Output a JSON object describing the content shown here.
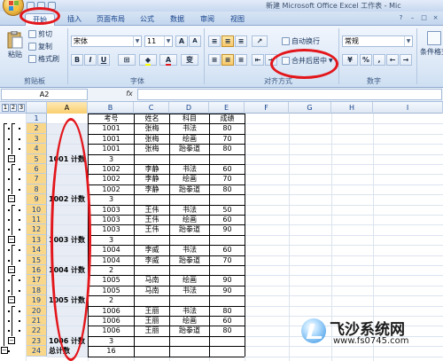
{
  "window": {
    "title": "新建 Microsoft Office Excel 工作表 - Mic"
  },
  "tabs": [
    {
      "label": "开始",
      "active": true
    },
    {
      "label": "插入"
    },
    {
      "label": "页面布局"
    },
    {
      "label": "公式"
    },
    {
      "label": "数据"
    },
    {
      "label": "审阅"
    },
    {
      "label": "视图"
    }
  ],
  "ribbon": {
    "clipboard": {
      "paste": "粘贴",
      "cut": "剪切",
      "copy": "复制",
      "format_painter": "格式刷",
      "label": "剪贴板"
    },
    "font": {
      "name": "宋体",
      "size": "11",
      "grow": "A",
      "shrink": "A",
      "bold": "B",
      "italic": "I",
      "underline": "U",
      "color_letter": "A",
      "phonetic": "变",
      "label": "字体"
    },
    "alignment": {
      "wrap": "自动换行",
      "merge": "合并后居中",
      "label": "对齐方式"
    },
    "number": {
      "format": "常规",
      "percent": "%",
      "comma": ",",
      "label": "数字"
    },
    "styles": {
      "conditional": "条件格式"
    }
  },
  "formula_bar": {
    "name_box": "A2",
    "fx": "fx",
    "value": ""
  },
  "outline_levels": [
    "1",
    "2",
    "3"
  ],
  "columns": [
    "A",
    "B",
    "C",
    "D",
    "E",
    "F",
    "G",
    "H",
    "I"
  ],
  "rows": [
    {
      "n": "1",
      "a": "",
      "b": "考号",
      "c": "姓名",
      "d": "科目",
      "e": "成绩"
    },
    {
      "n": "2",
      "a": "",
      "b": "1001",
      "c": "张梅",
      "d": "书法",
      "e": "80"
    },
    {
      "n": "3",
      "a": "",
      "b": "1001",
      "c": "张梅",
      "d": "绘画",
      "e": "70"
    },
    {
      "n": "4",
      "a": "",
      "b": "1001",
      "c": "张梅",
      "d": "跆拳道",
      "e": "80"
    },
    {
      "n": "5",
      "a": "1001 计数",
      "b": "3",
      "c": "",
      "d": "",
      "e": ""
    },
    {
      "n": "6",
      "a": "",
      "b": "1002",
      "c": "李静",
      "d": "书法",
      "e": "60"
    },
    {
      "n": "7",
      "a": "",
      "b": "1002",
      "c": "李静",
      "d": "绘画",
      "e": "70"
    },
    {
      "n": "8",
      "a": "",
      "b": "1002",
      "c": "李静",
      "d": "跆拳道",
      "e": "80"
    },
    {
      "n": "9",
      "a": "1002 计数",
      "b": "3",
      "c": "",
      "d": "",
      "e": ""
    },
    {
      "n": "10",
      "a": "",
      "b": "1003",
      "c": "王伟",
      "d": "书法",
      "e": "50"
    },
    {
      "n": "11",
      "a": "",
      "b": "1003",
      "c": "王伟",
      "d": "绘画",
      "e": "60"
    },
    {
      "n": "12",
      "a": "",
      "b": "1003",
      "c": "王伟",
      "d": "跆拳道",
      "e": "90"
    },
    {
      "n": "13",
      "a": "1003 计数",
      "b": "3",
      "c": "",
      "d": "",
      "e": ""
    },
    {
      "n": "14",
      "a": "",
      "b": "1004",
      "c": "李威",
      "d": "书法",
      "e": "60"
    },
    {
      "n": "15",
      "a": "",
      "b": "1004",
      "c": "李威",
      "d": "跆拳道",
      "e": "70"
    },
    {
      "n": "16",
      "a": "1004 计数",
      "b": "2",
      "c": "",
      "d": "",
      "e": ""
    },
    {
      "n": "17",
      "a": "",
      "b": "1005",
      "c": "马南",
      "d": "绘画",
      "e": "90"
    },
    {
      "n": "18",
      "a": "",
      "b": "1005",
      "c": "马南",
      "d": "书法",
      "e": "90"
    },
    {
      "n": "19",
      "a": "1005 计数",
      "b": "2",
      "c": "",
      "d": "",
      "e": ""
    },
    {
      "n": "20",
      "a": "",
      "b": "1006",
      "c": "王丽",
      "d": "书法",
      "e": "80"
    },
    {
      "n": "21",
      "a": "",
      "b": "1006",
      "c": "王丽",
      "d": "绘画",
      "e": "60"
    },
    {
      "n": "22",
      "a": "",
      "b": "1006",
      "c": "王丽",
      "d": "跆拳道",
      "e": "80"
    },
    {
      "n": "23",
      "a": "1006 计数",
      "b": "3",
      "c": "",
      "d": "",
      "e": ""
    },
    {
      "n": "24",
      "a": "总计数",
      "b": "16",
      "c": "",
      "d": "",
      "e": ""
    }
  ],
  "watermark": {
    "name": "飞沙系统网",
    "url": "www.fs0745.com"
  },
  "colors": {
    "annotation": "#e3161b",
    "selection": "#f9d78a",
    "ribbon": "#dbe7f6"
  }
}
